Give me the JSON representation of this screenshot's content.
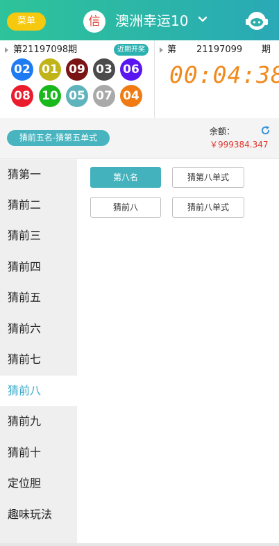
{
  "header": {
    "menu_label": "菜单",
    "xin_label": "信",
    "title": "澳洲幸运10",
    "icons": {
      "chevron": "chevron-down-icon",
      "service": "customer-service-icon"
    }
  },
  "lottery": {
    "prev_period": "第21197098期",
    "recent_label": "近期开奖",
    "balls": [
      {
        "num": "02",
        "color": "#1e7bf2"
      },
      {
        "num": "01",
        "color": "#c0b418"
      },
      {
        "num": "09",
        "color": "#7a1313"
      },
      {
        "num": "03",
        "color": "#4b4b4b"
      },
      {
        "num": "06",
        "color": "#5a16f0"
      },
      {
        "num": "08",
        "color": "#ea1d2e"
      },
      {
        "num": "10",
        "color": "#19b81d"
      },
      {
        "num": "05",
        "color": "#5fb3bc"
      },
      {
        "num": "07",
        "color": "#a9a9a9"
      },
      {
        "num": "04",
        "color": "#f07b12"
      }
    ],
    "current_label_a": "第",
    "current_period": "21197099",
    "current_label_b": "期",
    "countdown": "00:04:38"
  },
  "betbar": {
    "play_type": "猜前五名-猜第五单式",
    "balance_label": "余额：",
    "balance_value": "￥999384.347"
  },
  "nav": {
    "items": [
      "猜第一",
      "猜前二",
      "猜前三",
      "猜前四",
      "猜前五",
      "猜前六",
      "猜前七",
      "猜前八",
      "猜前九",
      "猜前十",
      "定位胆",
      "趣味玩法"
    ],
    "active_index": 7
  },
  "options": {
    "row1": [
      "第八名",
      "猜第八单式"
    ],
    "row2": [
      "猜前八",
      "猜前八单式"
    ],
    "selected": "第八名"
  },
  "colors": {
    "header_gradient_start": "#2ec39a",
    "header_gradient_end": "#2aa9b6",
    "accent": "#43b2bd",
    "countdown": "#f08a1d",
    "balance": "#e0342a"
  }
}
